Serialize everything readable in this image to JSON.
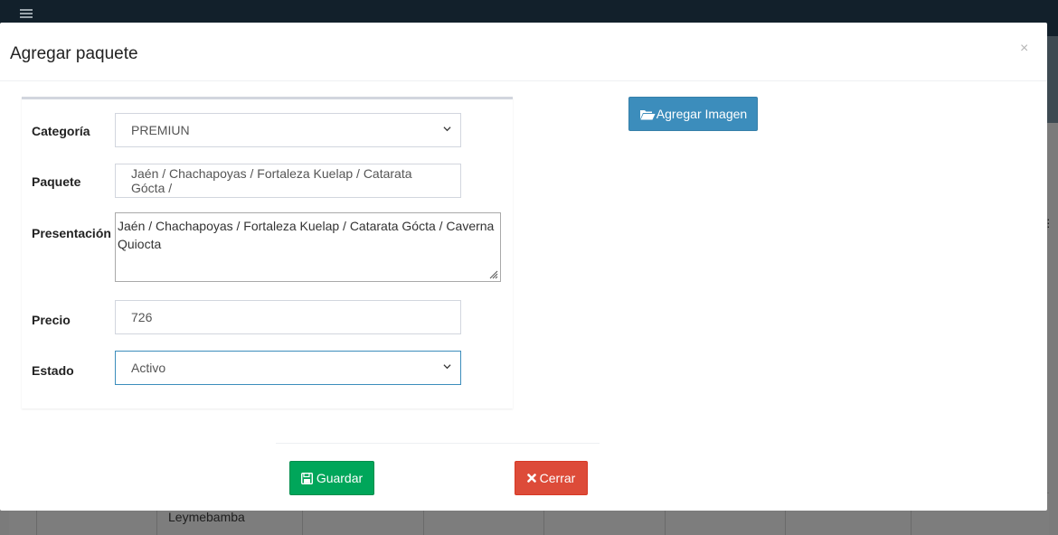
{
  "modal": {
    "title": "Agregar paquete",
    "close_glyph": "×"
  },
  "form": {
    "categoria": {
      "label": "Categoría",
      "value": "PREMIUN"
    },
    "paquete": {
      "label": "Paquete",
      "value": "Jaén / Chachapoyas / Fortaleza Kuelap / Catarata Gócta /"
    },
    "presentacion": {
      "label": "Presentación",
      "value": "Jaén / Chachapoyas / Fortaleza Kuelap / Catarata Gócta / Caverna Quiocta"
    },
    "precio": {
      "label": "Precio",
      "value": "726"
    },
    "estado": {
      "label": "Estado",
      "value": "Activo"
    }
  },
  "buttons": {
    "add_image": "Agregar Imagen",
    "save": "Guardar",
    "close": "Cerrar"
  },
  "background": {
    "table_cell": "Leymebamba"
  },
  "icons": {
    "add_image": "folder-open-icon",
    "save": "floppy-disk-icon",
    "close": "times-icon",
    "menu": "hamburger-icon"
  },
  "colors": {
    "primary": "#3c8dbc",
    "success": "#00a65a",
    "danger": "#dd4b39"
  }
}
